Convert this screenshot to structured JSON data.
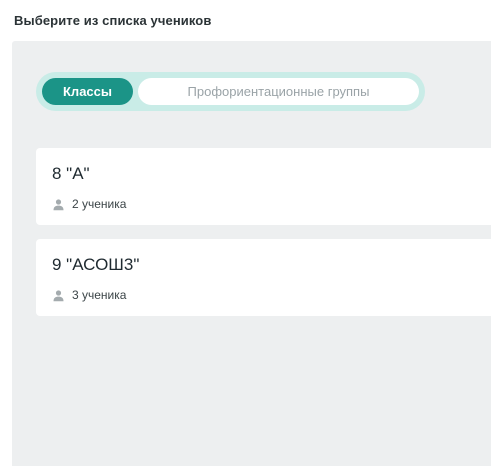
{
  "header": {
    "title": "Выберите из списка учеников"
  },
  "tabs": [
    {
      "label": "Классы",
      "active": true
    },
    {
      "label": "Профориентационные группы",
      "active": false
    }
  ],
  "classes": [
    {
      "name": "8 \"А\"",
      "students": "2 ученика",
      "icon": "person-icon"
    },
    {
      "name": "9 \"АСОШ3\"",
      "students": "3 ученика",
      "icon": "person-icon"
    }
  ],
  "colors": {
    "accent": "#1b9487",
    "segment_bg": "#c9ece7",
    "panel_bg": "#edeff0",
    "card_bg": "#ffffff",
    "inactive_text": "#9aa3a7"
  }
}
